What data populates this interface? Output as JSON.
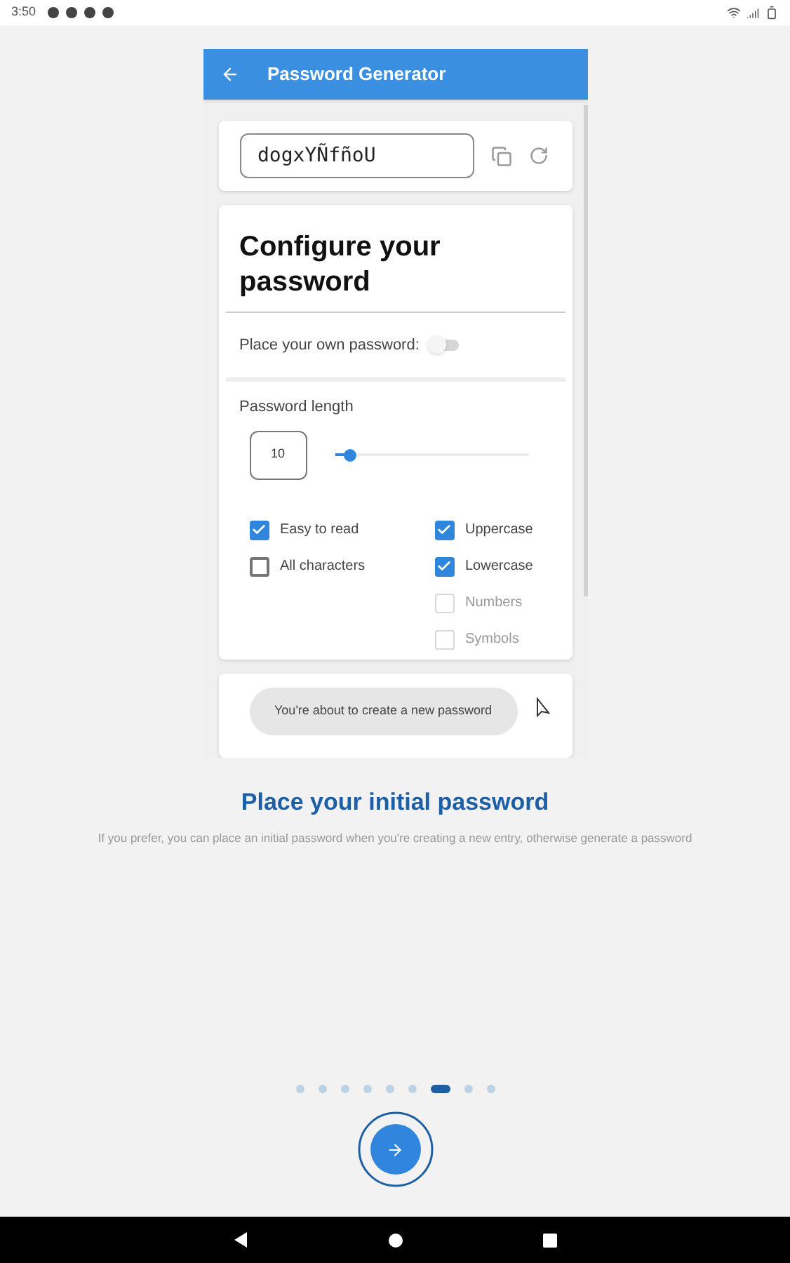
{
  "status_bar": {
    "time": "3:50"
  },
  "preview": {
    "app_bar": {
      "title": "Password Generator"
    },
    "password": {
      "value": "dogxYÑfñoU"
    },
    "config": {
      "title": "Configure your password",
      "own_password": {
        "label": "Place your own password:",
        "on": false
      },
      "length": {
        "label": "Password length",
        "value": "10",
        "level": 0.08
      },
      "options_left": [
        {
          "label": "Easy to read",
          "checked": true,
          "disabled": false
        },
        {
          "label": "All characters",
          "checked": false,
          "disabled": false
        }
      ],
      "options_right": [
        {
          "label": "Uppercase",
          "checked": true,
          "disabled": false
        },
        {
          "label": "Lowercase",
          "checked": true,
          "disabled": false
        },
        {
          "label": "Numbers",
          "checked": false,
          "disabled": true
        },
        {
          "label": "Symbols",
          "checked": false,
          "disabled": true
        }
      ]
    },
    "toast": "You're about to create a new password"
  },
  "title": "Place your initial password",
  "description": "If you prefer, you can place an initial password when you're creating a new entry, otherwise generate a password",
  "pager": [
    {
      "selected": false
    },
    {
      "selected": false
    },
    {
      "selected": false
    },
    {
      "selected": false
    },
    {
      "selected": false
    },
    {
      "selected": false
    },
    {
      "selected": true
    },
    {
      "selected": false
    },
    {
      "selected": false
    }
  ]
}
